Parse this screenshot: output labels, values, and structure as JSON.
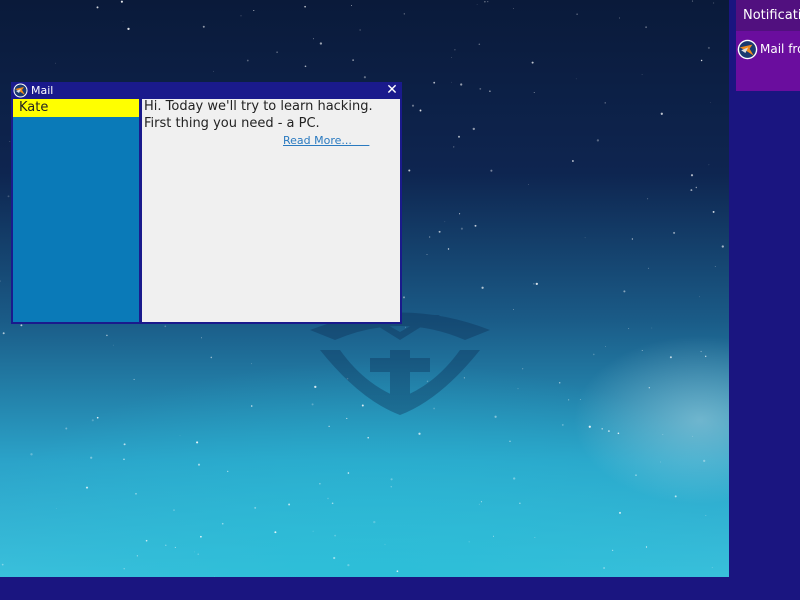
{
  "mail_window": {
    "title": "Mail",
    "title_icon": "mail-bird-icon",
    "close_glyph": "✕",
    "contacts": [
      "Kate"
    ],
    "selected_contact": "Kate",
    "message_lines": [
      "Hi. Today we'll try to learn hacking.",
      "First thing you need - a PC."
    ],
    "read_more_label": "Read More...     "
  },
  "notifications": {
    "header": "Notifications",
    "items": [
      {
        "text": "Mail from Kate",
        "icon": "mail-bird-icon"
      }
    ]
  },
  "colors": {
    "window_frame": "#1a1a8c",
    "contact_list_bg": "#0a7ab8",
    "selected_contact_bg": "#ffff00",
    "notification_bg": "#6a0d9e",
    "link": "#2a7ac0"
  }
}
